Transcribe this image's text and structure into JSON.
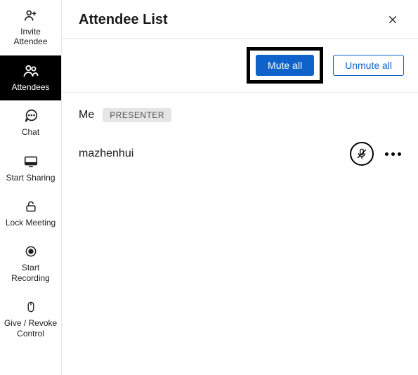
{
  "sidebar": {
    "items": [
      {
        "label": "Invite Attendee",
        "icon": "user-plus-icon"
      },
      {
        "label": "Attendees",
        "icon": "users-icon"
      },
      {
        "label": "Chat",
        "icon": "chat-icon"
      },
      {
        "label": "Start Sharing",
        "icon": "share-screen-icon"
      },
      {
        "label": "Lock Meeting",
        "icon": "lock-icon"
      },
      {
        "label": "Start Recording",
        "icon": "record-icon"
      },
      {
        "label": "Give / Revoke Control",
        "icon": "mouse-icon"
      }
    ],
    "active_index": 1
  },
  "header": {
    "title": "Attendee List"
  },
  "actions": {
    "mute_all": "Mute all",
    "unmute_all": "Unmute all"
  },
  "attendees": [
    {
      "name": "Me",
      "role_badge": "PRESENTER",
      "muted": false,
      "show_controls": false
    },
    {
      "name": "mazhenhui",
      "role_badge": null,
      "muted": true,
      "show_controls": true
    }
  ]
}
